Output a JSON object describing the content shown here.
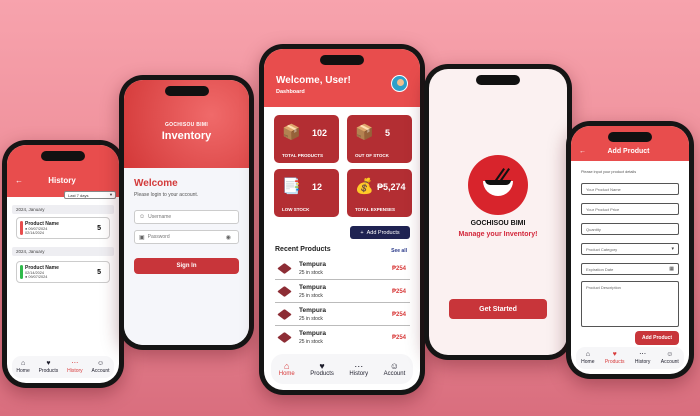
{
  "history_screen": {
    "title": "History",
    "filter": "Last 7 days",
    "groups": [
      {
        "label": "2024, January",
        "items": [
          {
            "name": "Product Name",
            "line1": "09/07/2024",
            "line2": "02/14/2024",
            "qty": "5",
            "color": "#e84d4d"
          }
        ]
      },
      {
        "label": "2024, January",
        "items": [
          {
            "name": "Product Name",
            "line1": "02/14/2024",
            "line2": "09/07/2024",
            "qty": "5",
            "color": "#2fba4b"
          }
        ]
      }
    ],
    "tabs": [
      "Home",
      "Products",
      "History",
      "Account"
    ]
  },
  "login_screen": {
    "brand": "GOCHISOU BIMI",
    "heading": "Inventory",
    "welcome": "Welcome",
    "subtitle": "Please login to your account.",
    "username_placeholder": "Username",
    "password_placeholder": "Password",
    "signin_label": "Sign In"
  },
  "dashboard_screen": {
    "greeting": "Welcome, User!",
    "section": "Dashboard",
    "stats": [
      {
        "value": "102",
        "label": "TOTAL PRODUCTS"
      },
      {
        "value": "5",
        "label": "OUT OF STOCK"
      },
      {
        "value": "12",
        "label": "LOW STOCK"
      },
      {
        "value": "₱5,274",
        "label": "TOTAL EXPENSES"
      }
    ],
    "add_products_label": "Add Products",
    "recent_title": "Recent Products",
    "see_all": "See all",
    "recent": [
      {
        "name": "Tempura",
        "stock": "25 in stock",
        "price": "₱254"
      },
      {
        "name": "Tempura",
        "stock": "25 in stock",
        "price": "₱254"
      },
      {
        "name": "Tempura",
        "stock": "25 in stock",
        "price": "₱254"
      },
      {
        "name": "Tempura",
        "stock": "25 in stock",
        "price": "₱254"
      }
    ],
    "tabs": [
      "Home",
      "Products",
      "History",
      "Account"
    ]
  },
  "splash_screen": {
    "name": "GOCHISOU BIMI",
    "tagline": "Manage your Inventory!",
    "button": "Get Started"
  },
  "add_product_screen": {
    "title": "Add Product",
    "note": "Please input your product details",
    "fields": [
      "Your Product Name",
      "Your Product Price",
      "Quantity",
      "Product Category",
      "Expiration Date",
      "Product Description"
    ],
    "button": "Add Product",
    "tabs": [
      "Home",
      "Products",
      "History",
      "Account"
    ]
  },
  "colors": {
    "primary": "#e84d4d",
    "dark_red": "#b32e33",
    "navy": "#1f2352",
    "accent_price": "#d83b3b"
  }
}
